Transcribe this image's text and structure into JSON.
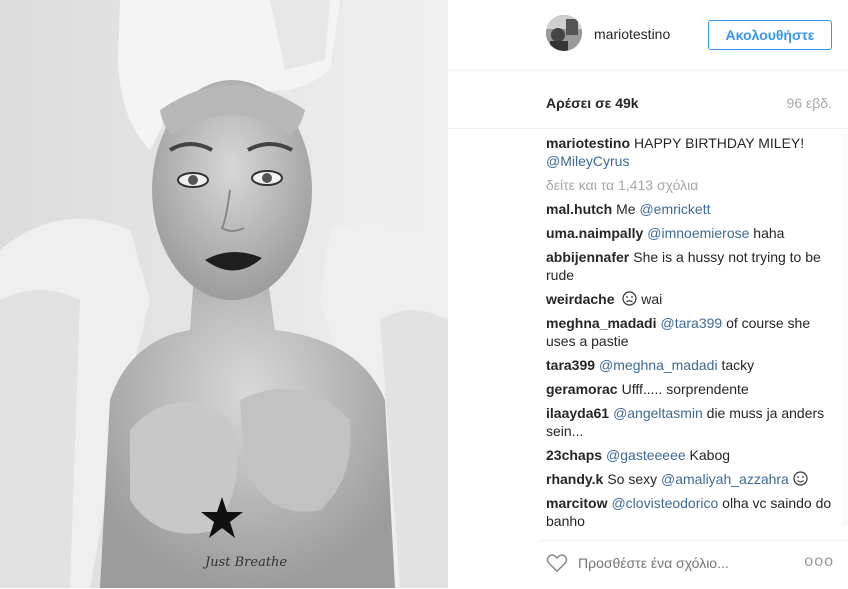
{
  "header": {
    "username": "mariotestino",
    "follow_label": "Ακολουθήστε"
  },
  "stats": {
    "likes": "Αρέσει σε 49k",
    "time": "96 εβδ."
  },
  "caption": {
    "user": "mariotestino",
    "text": "HAPPY BIRTHDAY MILEY!",
    "mention": "@MileyCyrus"
  },
  "view_all": "δείτε και τα 1,413 σχόλια",
  "comments": [
    {
      "user": "mal.hutch",
      "pre": "Me",
      "mention": "@emrickett",
      "post": ""
    },
    {
      "user": "uma.naimpally",
      "pre": "",
      "mention": "@imnoemierose",
      "post": "haha"
    },
    {
      "user": "abbijennafer",
      "pre": "She is a hussy not trying to be rude",
      "mention": "",
      "post": ""
    },
    {
      "user": "weirdache",
      "pre": "",
      "mention": "",
      "post": "wai",
      "emoji": "sad-face-icon"
    },
    {
      "user": "meghna_madadi",
      "pre": "",
      "mention": "@tara399",
      "post": "of course she uses a pastie"
    },
    {
      "user": "tara399",
      "pre": "",
      "mention": "@meghna_madadi",
      "post": "tacky"
    },
    {
      "user": "geramorac",
      "pre": "Ufff..... sorprendente",
      "mention": "",
      "post": ""
    },
    {
      "user": "ilaayda61",
      "pre": "",
      "mention": "@angeltasmin",
      "post": "die muss ja anders sein..."
    },
    {
      "user": "23chaps",
      "pre": "",
      "mention": "@gasteeeee",
      "post": "Kabog"
    },
    {
      "user": "rhandy.k",
      "pre": "So sexy",
      "mention": "@amaliyah_azzahra",
      "post": "",
      "emoji": "smile-face-icon"
    },
    {
      "user": "marcitow",
      "pre": "",
      "mention": "@clovisteodorico",
      "post": "olha vc saindo do banho"
    }
  ],
  "footer": {
    "comment_placeholder": "Προσθέστε ένα σχόλιο...",
    "more_label": "ooo"
  },
  "photo": {
    "tattoo_text": "Just Breathe"
  },
  "colors": {
    "accent": "#3897f0",
    "mention": "#3d6a94",
    "muted": "#a5a7aa"
  }
}
